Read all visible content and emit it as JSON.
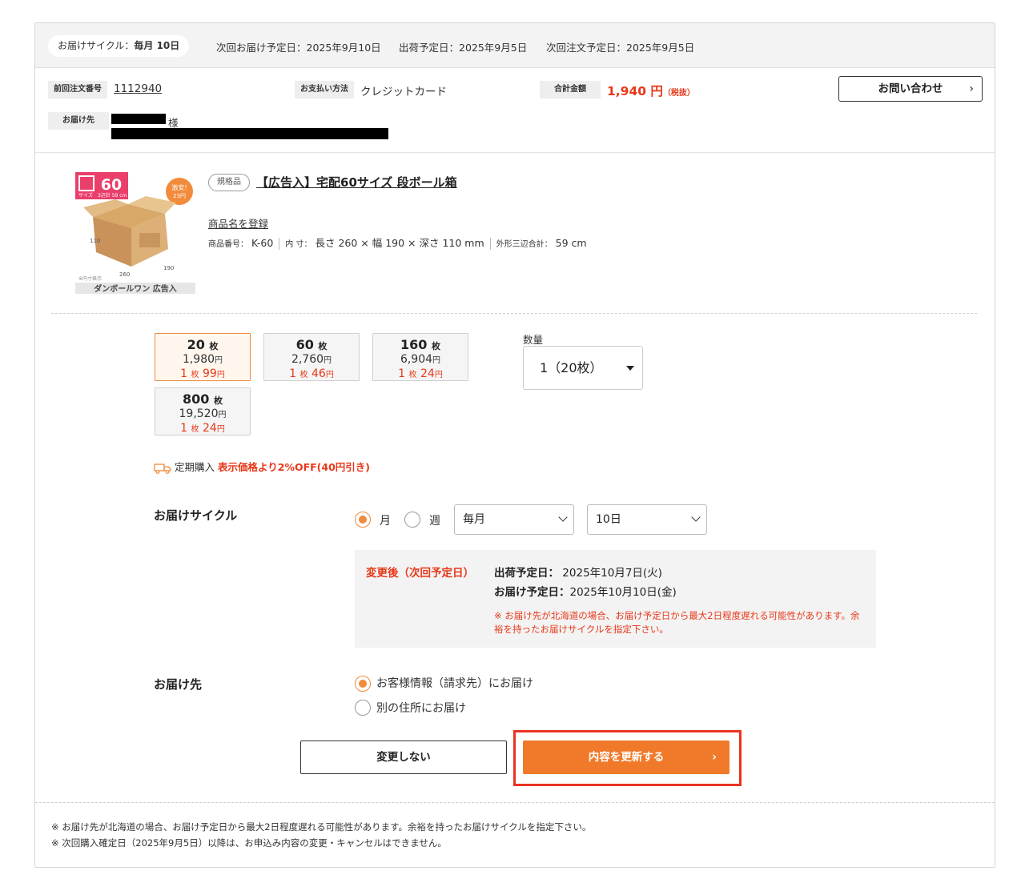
{
  "header": {
    "cycle_label": "お届けサイクル：",
    "cycle_value": "毎月 10日",
    "next_delivery": "次回お届け予定日：2025年9月10日",
    "ship_date": "出荷予定日：2025年9月5日",
    "next_order": "次回注文予定日：2025年9月5日"
  },
  "order_info": {
    "prev_order_label": "前回注文番号",
    "prev_order_no": "1112940",
    "payment_label": "お支払い方法",
    "payment_value": "クレジットカード",
    "total_label": "合計金額",
    "total_value": "1,940 円",
    "total_tax": "（税抜）",
    "inquiry_label": "お問い合わせ",
    "ship_to_label": "お届け先",
    "ship_to_suffix": "様"
  },
  "product": {
    "image_badge": "60",
    "image_badge_sub": "サイズ",
    "image_badge_note": "3辺計 59 cm",
    "image_sticker": "激安!",
    "image_sticker_price": "23円",
    "image_caption": "ダンボールワン 広告入",
    "image_dim_1": "110",
    "image_dim_2": "260",
    "image_dim_3": "190",
    "image_inner_note": "※内寸表示",
    "tag": "規格品",
    "title": "【広告入】宅配60サイズ 段ボール箱",
    "register_link": "商品名を登録",
    "code_label": "商品番号：",
    "code_value": "K-60",
    "inner_label": "内 寸：",
    "inner_value": "長さ 260 × 幅 190 × 深さ 110 mm",
    "outer_label": "外形三辺合計：",
    "outer_value": "59 cm"
  },
  "price_tiles": [
    {
      "qty": "20",
      "qty_unit": "枚",
      "price": "1,980",
      "price_unit": "円",
      "per_prefix": "1",
      "per_unit": "枚",
      "per_price": "99",
      "per_yen": "円"
    },
    {
      "qty": "60",
      "qty_unit": "枚",
      "price": "2,760",
      "price_unit": "円",
      "per_prefix": "1",
      "per_unit": "枚",
      "per_price": "46",
      "per_yen": "円"
    },
    {
      "qty": "160",
      "qty_unit": "枚",
      "price": "6,904",
      "price_unit": "円",
      "per_prefix": "1",
      "per_unit": "枚",
      "per_price": "24",
      "per_yen": "円"
    },
    {
      "qty": "800",
      "qty_unit": "枚",
      "price": "19,520",
      "price_unit": "円",
      "per_prefix": "1",
      "per_unit": "枚",
      "per_price": "24",
      "per_yen": "円"
    }
  ],
  "quantity": {
    "label": "数量",
    "value": "1（20枚）"
  },
  "subscription": {
    "label": "定期購入",
    "discount": "表示価格より2%OFF(40円引き)"
  },
  "delivery_cycle": {
    "label": "お届けサイクル",
    "opt_month": "月",
    "opt_week": "週",
    "select_freq": "毎月",
    "select_day": "10日"
  },
  "after_change": {
    "title": "変更後（次回予定日）",
    "ship_label": "出荷予定日：",
    "ship_value": "2025年10月7日(火)",
    "delivery_label": "お届け予定日：",
    "delivery_value": "2025年10月10日(金)",
    "note": "※ お届け先が北海道の場合、お届け予定日から最大2日程度遅れる可能性があります。余裕を持ったお届けサイクルを指定下さい。"
  },
  "destination": {
    "label": "お届け先",
    "opt_customer": "お客様情報（請求先）にお届け",
    "opt_other": "別の住所にお届け"
  },
  "buttons": {
    "no_change": "変更しない",
    "update": "内容を更新する"
  },
  "footnotes": [
    "※ お届け先が北海道の場合、お届け予定日から最大2日程度遅れる可能性があります。余裕を持ったお届けサイクルを指定下さい。",
    "※ 次回購入確定日（2025年9月5日）以降は、お申込み内容の変更・キャンセルはできません。"
  ],
  "colors": {
    "accent": "#f07a2a",
    "red": "#e8381a",
    "highlight": "#ea3323"
  }
}
